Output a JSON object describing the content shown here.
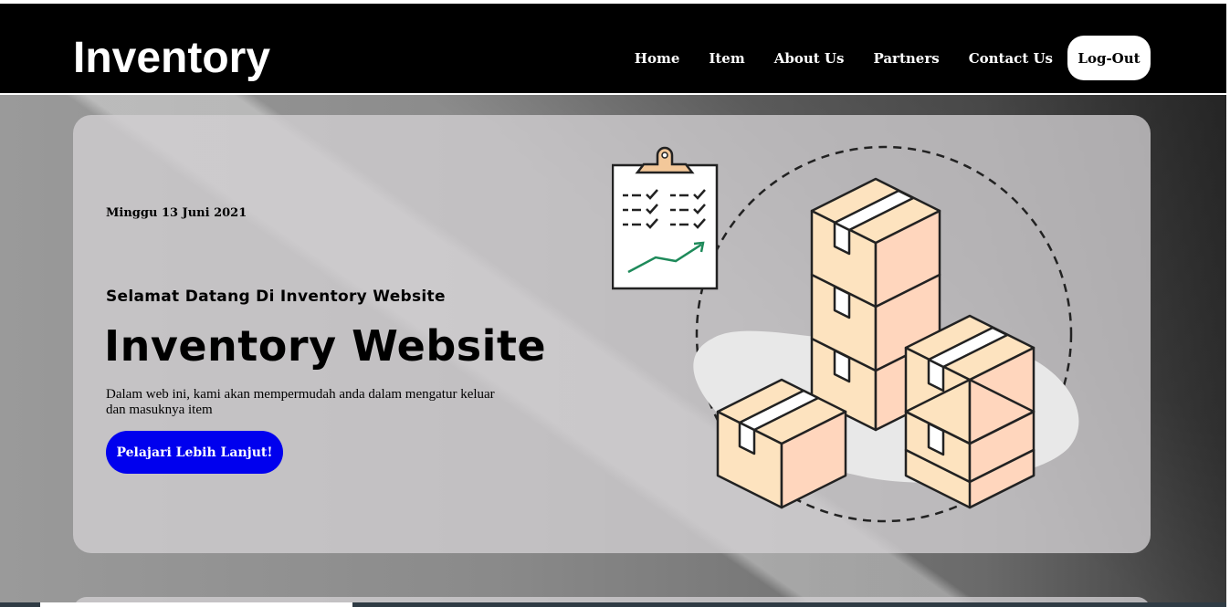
{
  "brand": {
    "logo": "Inventory"
  },
  "nav": {
    "items": [
      "Home",
      "Item",
      "About Us",
      "Partners",
      "Contact Us"
    ],
    "logout_label": "Log-Out"
  },
  "hero": {
    "date": "Minggu 13 Juni 2021",
    "subtitle": "Selamat Datang Di Inventory Website",
    "title": "Inventory Website",
    "description": "Dalam web ini, kami akan mempermudah anda dalam mengatur keluar dan masuknya item",
    "cta_label": "Pelajari Lebih Lanjut!",
    "illustration": "boxes-clipboard-illustration"
  },
  "colors": {
    "header_bg": "#000000",
    "cta_bg": "#0000ee",
    "box_fill": "#fde3bf",
    "box_side": "#ffd8bf"
  }
}
